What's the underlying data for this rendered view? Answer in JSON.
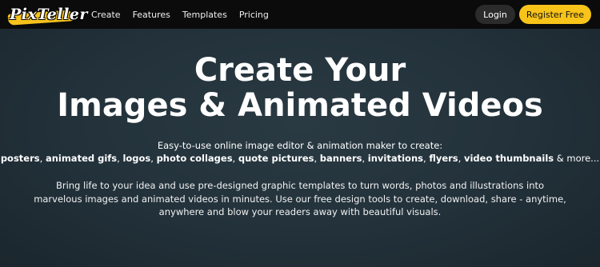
{
  "brand": {
    "logo_text": "PixTeller",
    "accent_color": "#f8c419"
  },
  "nav": {
    "links": [
      {
        "label": "Create"
      },
      {
        "label": "Features"
      },
      {
        "label": "Templates"
      },
      {
        "label": "Pricing"
      }
    ],
    "login_label": "Login",
    "register_label": "Register Free"
  },
  "hero": {
    "title_line1": "Create Your",
    "title_line2": "Images & Animated Videos",
    "subtitle_intro": "Easy-to-use online image editor & animation maker to create:",
    "features": [
      "posters",
      "animated gifs",
      "logos",
      "photo collages",
      "quote pictures",
      "banners",
      "invitations",
      "flyers",
      "video thumbnails"
    ],
    "features_suffix": "& more...",
    "description": "Bring life to your idea and use pre-designed graphic templates to turn words, photos and illustrations into marvelous images and animated videos in minutes. Use our free design tools to create, download, share - anytime, anywhere and blow your readers away with beautiful visuals."
  }
}
